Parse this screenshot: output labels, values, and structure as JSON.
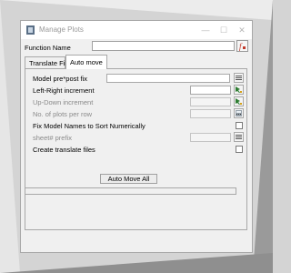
{
  "window": {
    "title": "Manage Plots",
    "minimize_glyph": "—",
    "maximize_glyph": "☐",
    "close_glyph": "✕"
  },
  "function_name": {
    "label": "Function Name",
    "value": ""
  },
  "tabs": [
    {
      "label": "Translate File",
      "selected": false
    },
    {
      "label": "Auto move",
      "selected": true
    }
  ],
  "auto_move": {
    "model_prepost_fix": {
      "label": "Model pre*post fix",
      "value": ""
    },
    "left_right_increment": {
      "label": "Left-Right increment",
      "value": ""
    },
    "up_down_increment": {
      "label": "Up-Down increment",
      "value": "",
      "disabled": true
    },
    "plots_per_row": {
      "label": "No. of plots per row",
      "value": "",
      "disabled": true
    },
    "fix_model_names": {
      "label": "Fix Model Names to Sort Numerically",
      "checked": false
    },
    "sheet_prefix": {
      "label": "sheet# prefix",
      "value": "",
      "disabled": true
    },
    "create_translate_files": {
      "label": "Create translate files",
      "checked": false
    },
    "action_button": "Auto Move All"
  },
  "colors": {
    "accent_red": "#c0392b",
    "icon_green": "#2e7d32",
    "icon_amber": "#d4a017"
  }
}
